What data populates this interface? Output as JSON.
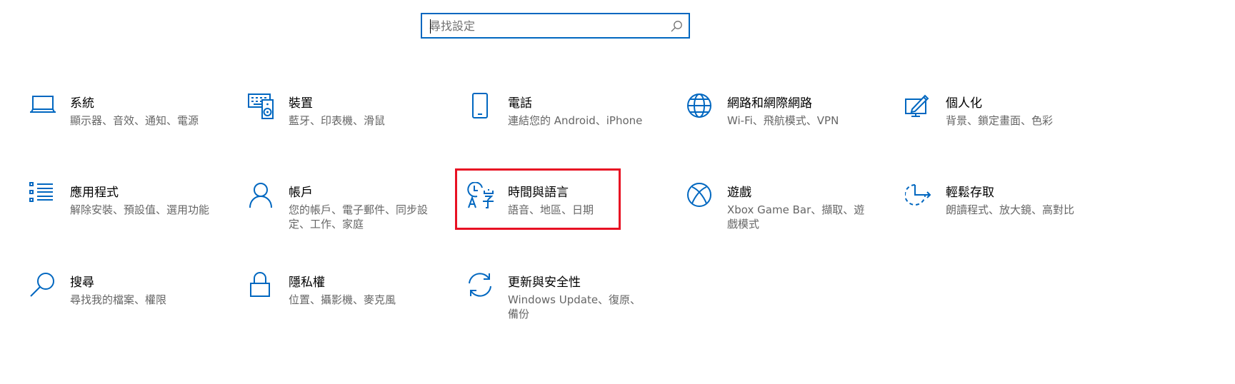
{
  "search": {
    "placeholder": "尋找設定"
  },
  "colors": {
    "accent": "#0067c0",
    "highlight": "#e81123",
    "description_text": "#666666"
  },
  "tiles": [
    {
      "title": "系統",
      "description": "顯示器、音效、通知、電源",
      "icon": "laptop-icon"
    },
    {
      "title": "裝置",
      "description": "藍牙、印表機、滑鼠",
      "icon": "devices-icon"
    },
    {
      "title": "電話",
      "description": "連結您的 Android、iPhone",
      "icon": "phone-icon"
    },
    {
      "title": "網路和網際網路",
      "description": "Wi-Fi、飛航模式、VPN",
      "icon": "globe-icon"
    },
    {
      "title": "個人化",
      "description": "背景、鎖定畫面、色彩",
      "icon": "personalization-icon"
    },
    {
      "title": "應用程式",
      "description": "解除安裝、預設值、選用功能",
      "icon": "apps-list-icon"
    },
    {
      "title": "帳戶",
      "description": "您的帳戶、電子郵件、同步設定、工作、家庭",
      "icon": "person-icon"
    },
    {
      "title": "時間與語言",
      "description": "語音、地區、日期",
      "icon": "time-language-icon"
    },
    {
      "title": "遊戲",
      "description": "Xbox Game Bar、擷取、遊戲模式",
      "icon": "xbox-icon"
    },
    {
      "title": "輕鬆存取",
      "description": "朗讀程式、放大鏡、高對比",
      "icon": "ease-of-access-icon"
    },
    {
      "title": "搜尋",
      "description": "尋找我的檔案、權限",
      "icon": "search-magnifier-icon"
    },
    {
      "title": "隱私權",
      "description": "位置、攝影機、麥克風",
      "icon": "lock-icon"
    },
    {
      "title": "更新與安全性",
      "description": "Windows Update、復原、備份",
      "icon": "sync-icon"
    }
  ]
}
